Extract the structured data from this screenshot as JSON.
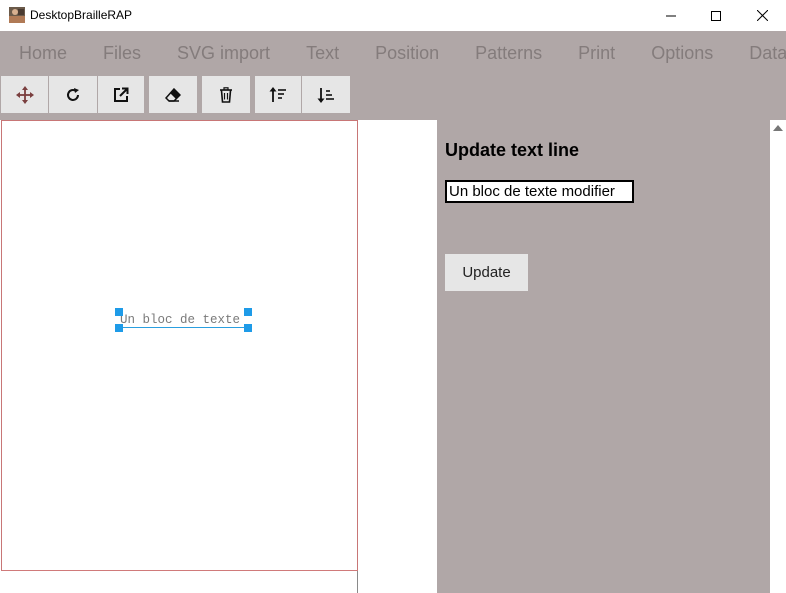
{
  "window": {
    "title": "DesktopBrailleRAP",
    "icon": "app-photo-icon"
  },
  "menu": {
    "items": [
      "Home",
      "Files",
      "SVG import",
      "Text",
      "Position",
      "Patterns",
      "Print",
      "Options",
      "Data"
    ]
  },
  "toolbar": {
    "buttons": [
      {
        "icon": "move-icon"
      },
      {
        "icon": "rotate-icon"
      },
      {
        "icon": "external-link-icon"
      },
      {
        "icon": "eraser-icon"
      },
      {
        "icon": "trash-icon"
      },
      {
        "icon": "sort-ascending-icon"
      },
      {
        "icon": "sort-descending-icon"
      }
    ]
  },
  "canvas": {
    "text_block": "Un bloc de texte"
  },
  "panel": {
    "title": "Update text line",
    "input_value": "Un bloc de texte modifier",
    "update_label": "Update"
  },
  "colors": {
    "menu_bg": "#b0a7a7",
    "menu_text": "#847c7c",
    "button_bg": "#e6e6e6",
    "page_border": "#c87676",
    "selection": "#1e9be8"
  }
}
